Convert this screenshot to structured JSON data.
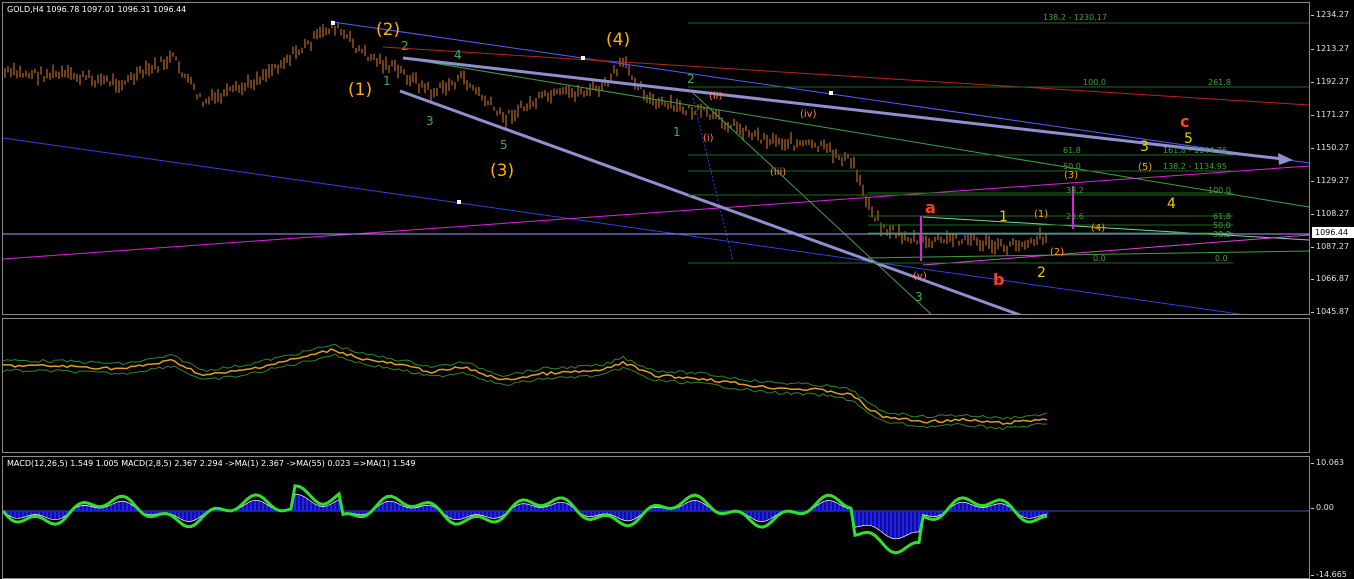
{
  "header": {
    "symbol_line": "GOLD,H4  1096.78 1097.01 1096.31 1096.44"
  },
  "indicator_header": "MACD(12,26,5) 1.549 1.005  MACD(2,8,5) 2.367 2.294  ->MA(1) 2.367  ->MA(55) 0.023  =>MA(1) 1.549",
  "price_axis": [
    "1234.27",
    "1213.27",
    "1192.27",
    "1171.27",
    "1150.27",
    "1129.27",
    "1108.27",
    "1087.27",
    "1066.87",
    "1045.87"
  ],
  "current_price": "1096.44",
  "macd_axis": [
    "10.063",
    "0.00",
    "-14.665"
  ],
  "wave_labels": {
    "w2_major": "(2)",
    "w1_major": "(1)",
    "w3_major": "(3)",
    "w4_major": "(4)",
    "g1": "1",
    "g2": "2",
    "g3": "3",
    "g4": "4",
    "g5": "5",
    "g1b": "1",
    "g2b": "2",
    "g3b": "3",
    "r_i": "(i)",
    "r_ii": "(ii)",
    "r_iii": "(iii)",
    "r_iv": "(iv)",
    "r_v": "(v)",
    "a": "a",
    "b": "b",
    "c": "c",
    "y1": "1",
    "y2": "2",
    "y3": "3",
    "y4": "4",
    "y5": "5",
    "o1": "(1)",
    "o2": "(2)",
    "o3": "(3)",
    "o4": "(4)",
    "o5": "(5)"
  },
  "fib_labels": {
    "f1382_top": "138.2 - 1230.17",
    "f100_top": "100.0",
    "f2618": "261.8",
    "f618a": "61.8",
    "f500a": "50.0",
    "f1618": "161.8 - 1144.76",
    "f1382": "138.2 - 1134.95",
    "f382": "38.2",
    "f1000": "100.0",
    "f236": "23.6",
    "f618b": "61.8",
    "f500b": "50.0",
    "f382b": "38.2",
    "f00a": "0.0",
    "f00b": "0.0"
  },
  "colors": {
    "candle": "#e08030",
    "orange_wave": "#ffb000",
    "green_wave": "#40b040",
    "red_wave": "#ff4020",
    "macd_green": "#30e030",
    "macd_blue": "#2020ff"
  }
}
